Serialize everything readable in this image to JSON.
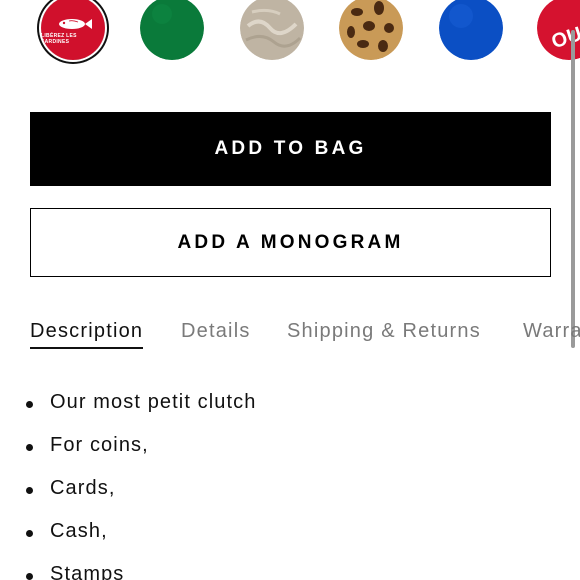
{
  "swatches": [
    {
      "name": "red-fish",
      "color": "#d0102c",
      "label": "LIBÉREZ LES SARDINES",
      "selected": true
    },
    {
      "name": "green",
      "color": "#0a7a3a",
      "label": "",
      "selected": false
    },
    {
      "name": "metallic-silver",
      "color": "#bfb4a3",
      "label": "",
      "selected": false
    },
    {
      "name": "leopard",
      "color": "#c99a57",
      "label": "",
      "selected": false
    },
    {
      "name": "blue",
      "color": "#0b4fc4",
      "label": "",
      "selected": false
    },
    {
      "name": "red-text",
      "color": "#d5122f",
      "label": "OUI P",
      "selected": false
    }
  ],
  "actions": {
    "add_to_bag_label": "ADD TO BAG",
    "add_monogram_label": "ADD A MONOGRAM"
  },
  "tabs": [
    {
      "label": "Description",
      "active": true
    },
    {
      "label": "Details",
      "active": false
    },
    {
      "label": "Shipping & Returns",
      "active": false
    },
    {
      "label": "Warra",
      "active": false
    }
  ],
  "description": {
    "items": [
      "Our most petit clutch",
      "For coins,",
      "Cards,",
      "Cash,",
      "Stamps"
    ]
  },
  "colors": {
    "primary_button_bg": "#000000",
    "primary_button_text": "#ffffff",
    "tab_active": "#111111",
    "tab_inactive": "#7a7a7a"
  }
}
